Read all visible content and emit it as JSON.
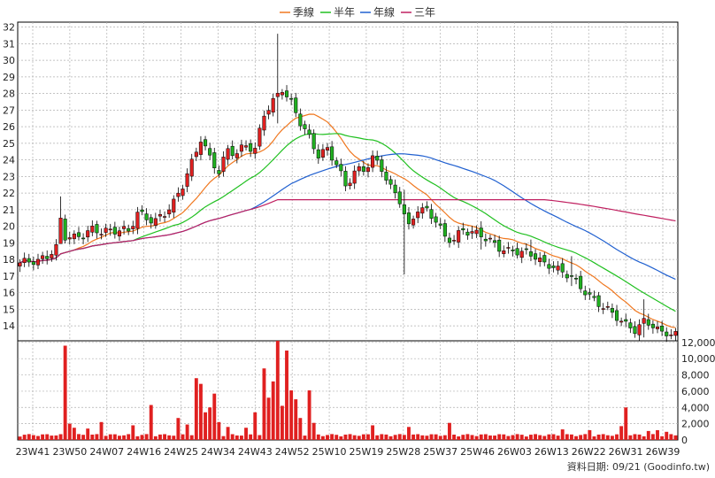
{
  "legend": [
    {
      "label": "季線",
      "color": "#f07820"
    },
    {
      "label": "半年",
      "color": "#20c020"
    },
    {
      "label": "年線",
      "color": "#2060d0"
    },
    {
      "label": "三年",
      "color": "#c02060"
    }
  ],
  "footer_note": "資料日期: 09/21 (Goodinfo.tw)",
  "colors": {
    "up": "#e02020",
    "down": "#20b020",
    "volume": "#e02020",
    "grid": "#b0b0b0"
  },
  "chart_data": [
    {
      "type": "candlestick",
      "title": "",
      "x_tick_labels": [
        "23W41",
        "23W50",
        "24W07",
        "24W16",
        "24W25",
        "24W34",
        "24W43",
        "24W52",
        "25W10",
        "25W19",
        "25W28",
        "25W37",
        "25W46",
        "26W03",
        "26W13",
        "26W22",
        "26W31",
        "26W39"
      ],
      "y_ticks": [
        14,
        15,
        16,
        17,
        18,
        19,
        20,
        21,
        22,
        23,
        24,
        25,
        26,
        27,
        28,
        29,
        30,
        31,
        32
      ],
      "ylim": [
        13.1,
        32.3
      ],
      "grid": true,
      "close_anchors": [
        [
          0,
          17.8
        ],
        [
          2,
          17.9
        ],
        [
          4,
          17.9
        ],
        [
          6,
          18.2
        ],
        [
          8,
          18.7
        ],
        [
          9,
          20.4
        ],
        [
          10,
          19.4
        ],
        [
          12,
          19.3
        ],
        [
          14,
          19.5
        ],
        [
          16,
          19.8
        ],
        [
          18,
          19.7
        ],
        [
          20,
          19.7
        ],
        [
          22,
          19.8
        ],
        [
          24,
          19.7
        ],
        [
          26,
          20.8
        ],
        [
          28,
          20.5
        ],
        [
          30,
          20.3
        ],
        [
          32,
          20.8
        ],
        [
          34,
          21.4
        ],
        [
          36,
          22.5
        ],
        [
          38,
          23.8
        ],
        [
          40,
          25.3
        ],
        [
          42,
          24.1
        ],
        [
          44,
          23.3
        ],
        [
          46,
          24.6
        ],
        [
          48,
          24.4
        ],
        [
          50,
          24.9
        ],
        [
          52,
          24.6
        ],
        [
          54,
          26.8
        ],
        [
          56,
          27.5
        ],
        [
          58,
          28.3
        ],
        [
          60,
          27.4
        ],
        [
          62,
          26.3
        ],
        [
          64,
          25.3
        ],
        [
          66,
          24.3
        ],
        [
          68,
          24.6
        ],
        [
          70,
          23.8
        ],
        [
          72,
          22.4
        ],
        [
          74,
          23.3
        ],
        [
          76,
          23.4
        ],
        [
          78,
          24.1
        ],
        [
          80,
          23.5
        ],
        [
          82,
          22.3
        ],
        [
          84,
          21.6
        ],
        [
          86,
          19.9
        ],
        [
          88,
          21.1
        ],
        [
          90,
          20.9
        ],
        [
          92,
          20.4
        ],
        [
          94,
          19.3
        ],
        [
          96,
          19.2
        ],
        [
          98,
          19.8
        ],
        [
          100,
          19.6
        ],
        [
          102,
          19.5
        ],
        [
          104,
          19.1
        ],
        [
          106,
          18.7
        ],
        [
          108,
          18.5
        ],
        [
          110,
          18.5
        ],
        [
          112,
          18.4
        ],
        [
          114,
          18.2
        ],
        [
          116,
          17.7
        ],
        [
          118,
          17.6
        ],
        [
          120,
          17.2
        ],
        [
          122,
          17.0
        ],
        [
          124,
          16.3
        ],
        [
          126,
          15.8
        ],
        [
          128,
          15.3
        ],
        [
          130,
          15.0
        ],
        [
          132,
          14.5
        ],
        [
          134,
          14.1
        ],
        [
          136,
          13.7
        ],
        [
          138,
          14.3
        ],
        [
          140,
          14.0
        ],
        [
          142,
          13.6
        ],
        [
          144,
          13.5
        ]
      ],
      "spikes": [
        [
          9,
          21.8,
          19.0
        ],
        [
          57,
          31.6,
          26.2
        ],
        [
          85,
          22.2,
          17.1
        ],
        [
          102,
          20.3,
          18.6
        ],
        [
          113,
          19.2,
          17.9
        ],
        [
          122,
          18.2,
          16.4
        ],
        [
          138,
          15.6,
          13.3
        ]
      ],
      "series": [
        {
          "name": "季線",
          "window": 13
        },
        {
          "name": "半年",
          "window": 26
        },
        {
          "name": "年線",
          "window": 52
        },
        {
          "name": "三年",
          "window": 156
        }
      ]
    },
    {
      "type": "bar",
      "title": "",
      "y_tick_labels": [
        "0",
        "2,000",
        "4,000",
        "6,000",
        "8,000",
        "10,000",
        "12,000"
      ],
      "y_ticks": [
        0,
        2000,
        4000,
        6000,
        8000,
        10000,
        12000
      ],
      "ylim": [
        0,
        12200
      ],
      "base_volume": 600,
      "volume_spikes": [
        [
          10,
          11600
        ],
        [
          11,
          2000
        ],
        [
          12,
          1500
        ],
        [
          15,
          1400
        ],
        [
          18,
          2200
        ],
        [
          25,
          1800
        ],
        [
          29,
          4300
        ],
        [
          35,
          2700
        ],
        [
          37,
          1900
        ],
        [
          39,
          7600
        ],
        [
          40,
          6900
        ],
        [
          41,
          3400
        ],
        [
          42,
          4000
        ],
        [
          43,
          5700
        ],
        [
          44,
          2200
        ],
        [
          46,
          1600
        ],
        [
          50,
          1500
        ],
        [
          52,
          3400
        ],
        [
          54,
          8800
        ],
        [
          55,
          5200
        ],
        [
          56,
          7200
        ],
        [
          57,
          12800
        ],
        [
          58,
          4200
        ],
        [
          59,
          11000
        ],
        [
          60,
          6100
        ],
        [
          61,
          5000
        ],
        [
          62,
          2700
        ],
        [
          64,
          6100
        ],
        [
          65,
          2100
        ],
        [
          78,
          1800
        ],
        [
          86,
          1600
        ],
        [
          95,
          2100
        ],
        [
          120,
          1300
        ],
        [
          126,
          1200
        ],
        [
          133,
          1700
        ],
        [
          134,
          4000
        ],
        [
          139,
          1100
        ],
        [
          141,
          1200
        ],
        [
          143,
          1000
        ]
      ]
    }
  ]
}
